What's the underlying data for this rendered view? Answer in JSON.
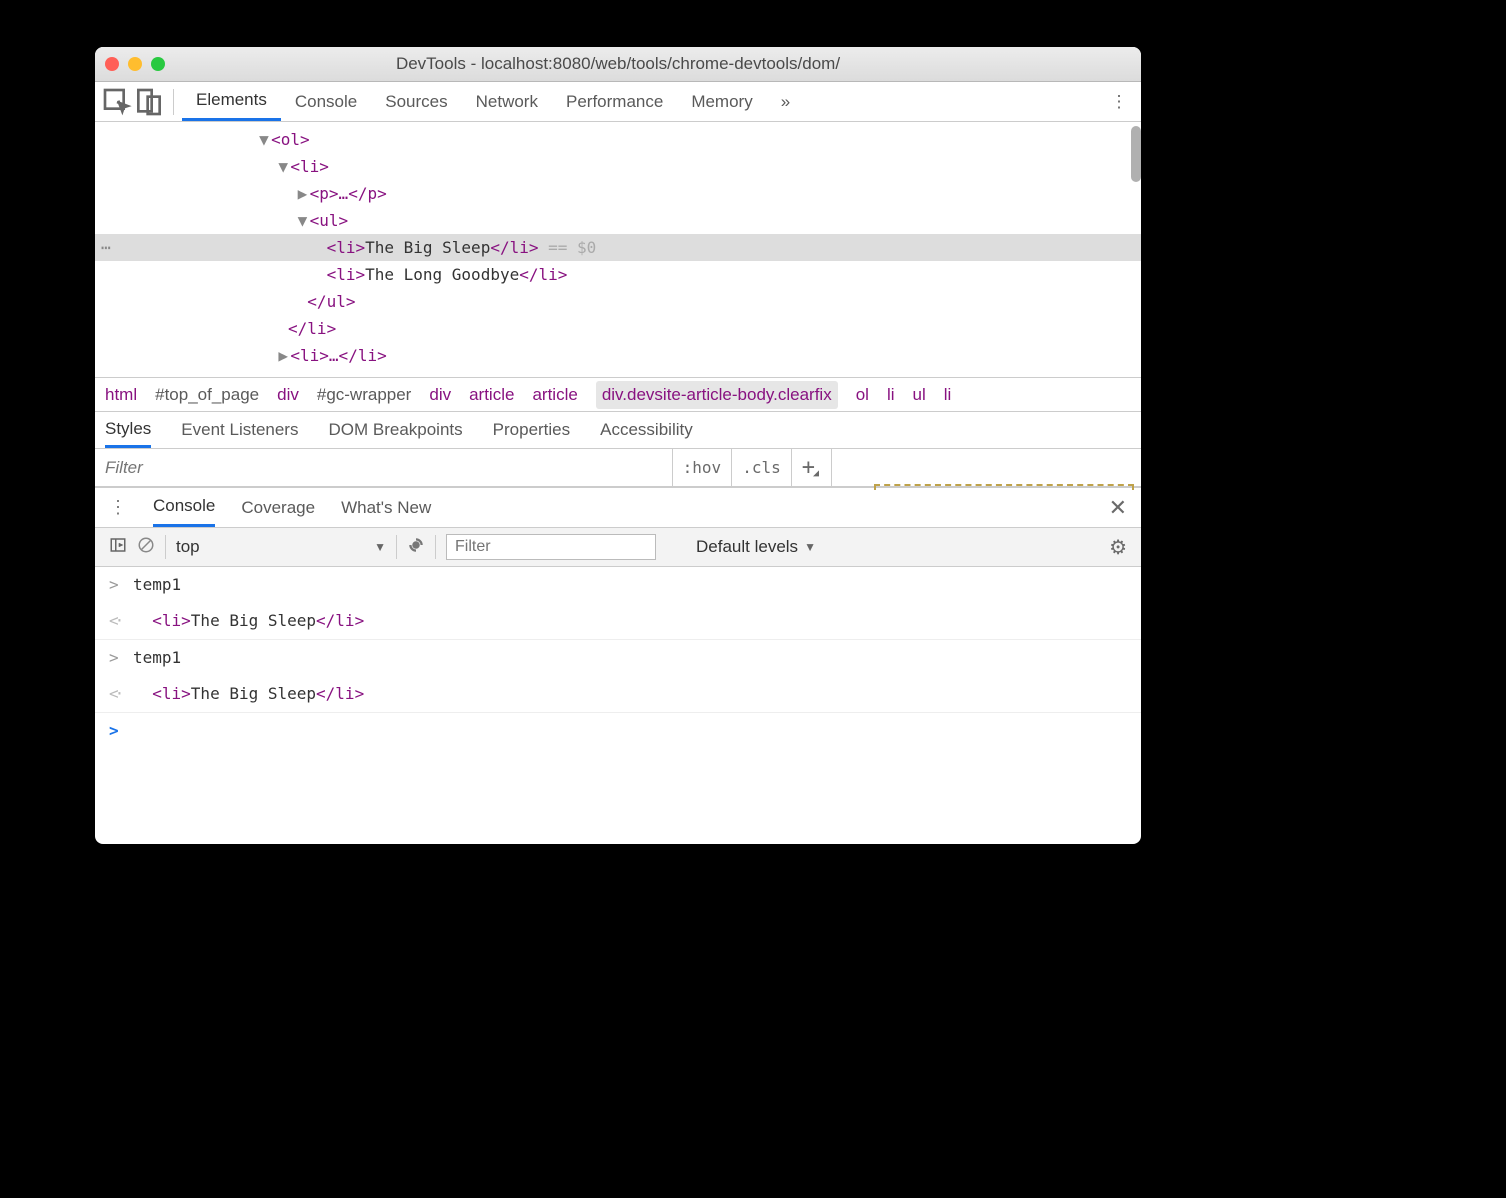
{
  "titlebar": {
    "title": "DevTools - localhost:8080/web/tools/chrome-devtools/dom/"
  },
  "tabs": {
    "elements": "Elements",
    "console": "Console",
    "sources": "Sources",
    "network": "Network",
    "performance": "Performance",
    "memory": "Memory"
  },
  "dom": {
    "ol_open": "<ol>",
    "li_open": "<li>",
    "p": "<p>…</p>",
    "ul_open": "<ul>",
    "li1_open": "<li>",
    "li1_text": "The Big Sleep",
    "li1_close": "</li>",
    "li1_suffix": " == $0",
    "li2_open": "<li>",
    "li2_text": "The Long Goodbye",
    "li2_close": "</li>",
    "ul_close": "</ul>",
    "li_close": "</li>",
    "li3": "<li>…</li>"
  },
  "crumbs": {
    "html": "html",
    "top": "#top_of_page",
    "div1": "div",
    "gc": "#gc-wrapper",
    "div2": "div",
    "article1": "article",
    "article2": "article",
    "body": "div.devsite-article-body.clearfix",
    "ol": "ol",
    "li": "li",
    "ul": "ul",
    "li2": "li"
  },
  "stabs": {
    "styles": "Styles",
    "listeners": "Event Listeners",
    "domBp": "DOM Breakpoints",
    "props": "Properties",
    "a11y": "Accessibility"
  },
  "filter": {
    "placeholder": "Filter",
    "hov": ":hov",
    "cls": ".cls"
  },
  "drawer": {
    "console": "Console",
    "coverage": "Coverage",
    "whats": "What's New"
  },
  "consoleToolbar": {
    "context": "top",
    "filterPlaceholder": "Filter",
    "levels": "Default levels"
  },
  "console": {
    "in1": "temp1",
    "out1_open": "<li>",
    "out1_text": "The Big Sleep",
    "out1_close": "</li>",
    "in2": "temp1",
    "out2_open": "<li>",
    "out2_text": "The Big Sleep",
    "out2_close": "</li>"
  }
}
